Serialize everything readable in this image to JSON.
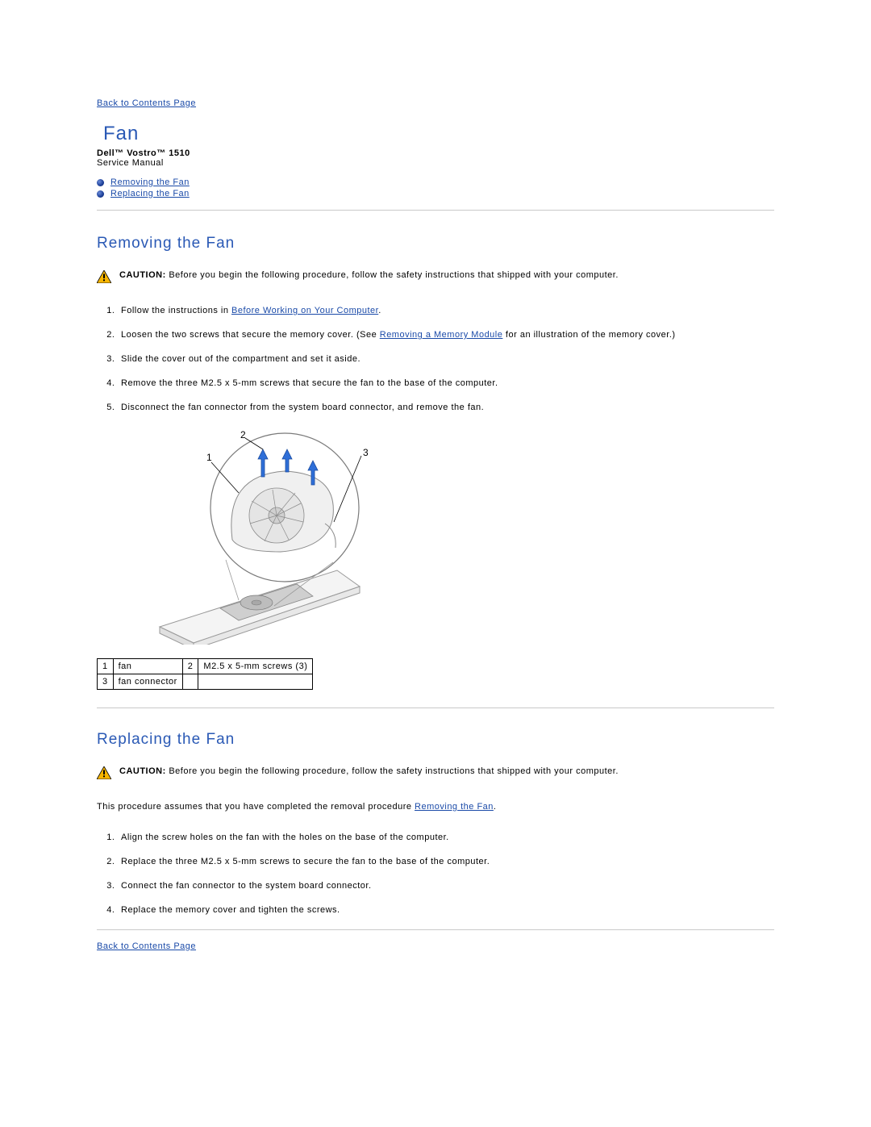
{
  "nav": {
    "back_top": "Back to Contents Page",
    "back_bottom": "Back to Contents Page"
  },
  "title": "Fan",
  "product": "Dell™ Vostro™ 1510",
  "subtitle": "Service Manual",
  "toc": {
    "item1": "Removing the Fan",
    "item2": "Replacing the Fan"
  },
  "section1": {
    "heading": "Removing the Fan",
    "caution_label": "CAUTION:",
    "caution_text": " Before you begin the following procedure, follow the safety instructions that shipped with your computer.",
    "step1_pre": "Follow the instructions in ",
    "step1_link": "Before Working on Your Computer",
    "step1_post": ".",
    "step2_pre": "Loosen the two screws that secure the memory cover. (See ",
    "step2_link": "Removing a Memory Module",
    "step2_post": " for an illustration of the memory cover.)",
    "step3": "Slide the cover out of the compartment and set it aside.",
    "step4": "Remove the three M2.5 x 5-mm screws that secure the fan to the base of the computer.",
    "step5": "Disconnect the fan connector from the system board connector, and remove the fan."
  },
  "figure": {
    "label1": "1",
    "label2": "2",
    "label3": "3"
  },
  "parts": {
    "r1c1": "1",
    "r1c2": "fan",
    "r1c3": "2",
    "r1c4": "M2.5 x 5-mm screws (3)",
    "r2c1": "3",
    "r2c2": "fan connector",
    "r2c3": "",
    "r2c4": ""
  },
  "section2": {
    "heading": "Replacing the Fan",
    "caution_label": "CAUTION:",
    "caution_text": " Before you begin the following procedure, follow the safety instructions that shipped with your computer.",
    "assume_pre": "This procedure assumes that you have completed the removal procedure ",
    "assume_link": "Removing the Fan",
    "assume_post": ".",
    "step1": "Align the screw holes on the fan with the holes on the base of the computer.",
    "step2": "Replace the three M2.5 x 5-mm screws to secure the fan to the base of the computer.",
    "step3": "Connect the fan connector to the system board connector.",
    "step4": "Replace the memory cover and tighten the screws."
  }
}
